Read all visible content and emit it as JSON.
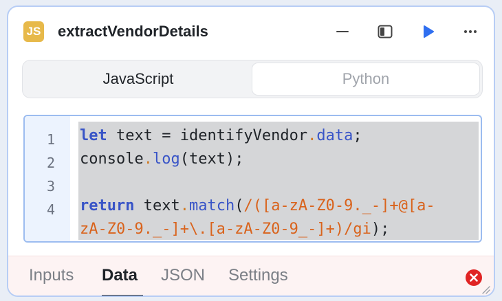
{
  "header": {
    "badge": "JS",
    "title": "extractVendorDetails"
  },
  "icons": {
    "minimize": "minus-icon",
    "panel": "panel-toggle-icon",
    "run": "play-icon",
    "more": "more-horizontal-icon",
    "error": "error-x-icon",
    "resize": "resize-handle-icon"
  },
  "language_tabs": [
    {
      "label": "JavaScript",
      "active": true
    },
    {
      "label": "Python",
      "active": false
    }
  ],
  "code": {
    "line_numbers": [
      "1",
      "2",
      "3",
      "4"
    ],
    "lines": [
      "let text = identifyVendor.data;",
      "console.log(text);",
      "",
      "return text.match(/([a-zA-Z0-9._-]+@[a-",
      "zA-Z0-9._-]+\\.[a-zA-Z0-9_-]+)/gi);"
    ]
  },
  "bottom_tabs": [
    {
      "label": "Inputs",
      "active": false
    },
    {
      "label": "Data",
      "active": true
    },
    {
      "label": "JSON",
      "active": false
    },
    {
      "label": "Settings",
      "active": false
    }
  ],
  "colors": {
    "accent": "#2f6ff0",
    "badge": "#e7b94a",
    "error": "#e02424"
  }
}
